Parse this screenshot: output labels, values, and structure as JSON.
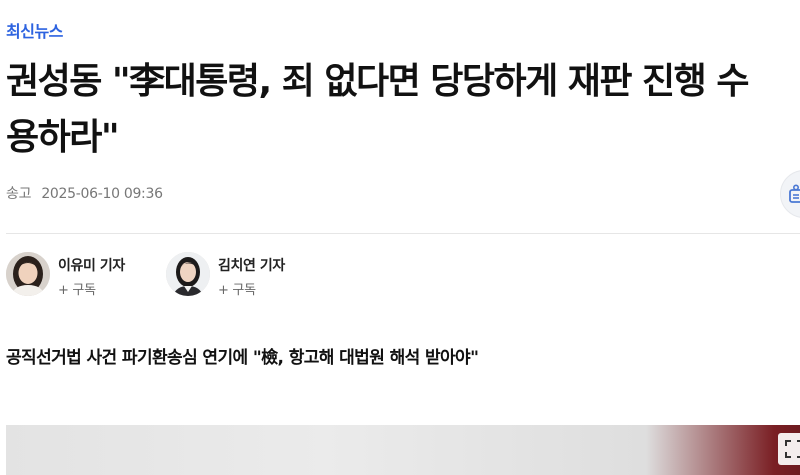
{
  "section": {
    "label": "최신뉴스"
  },
  "article": {
    "headline": "권성동 \"李대통령, 죄 없다면 당당하게 재판 진행 수용하라\"",
    "sent_label": "송고",
    "timestamp": "2025-06-10 09:36",
    "subheadline": "공직선거법 사건 파기환송심 연기에 \"檢, 항고해 대법원 해석 받아야\""
  },
  "reporters": [
    {
      "name": "이유미 기자",
      "subscribe": "+ 구독"
    },
    {
      "name": "김치연 기자",
      "subscribe": "+ 구독"
    }
  ],
  "icons": {
    "share": "share-icon",
    "expand": "expand-icon"
  },
  "colors": {
    "accent": "#2d63e0",
    "meta": "#777777"
  }
}
